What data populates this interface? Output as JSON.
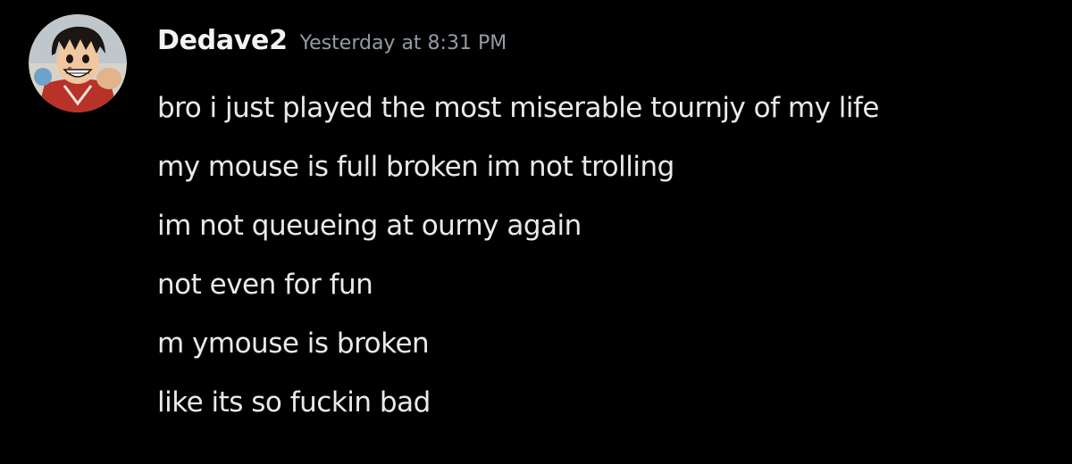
{
  "message": {
    "author": {
      "username": "Dedave2",
      "avatar": "anime-character-avatar"
    },
    "timestamp": "Yesterday at 8:31 PM",
    "lines": [
      "bro i just played the most miserable tournjy of my life",
      "my mouse is full broken im not trolling",
      "im not queueing at ourny again",
      "not even for fun",
      "m ymouse is broken",
      "like its so fuckin bad"
    ]
  },
  "colors": {
    "background": "#000000",
    "username": "#f2f3f5",
    "timestamp": "#949ba4",
    "text": "#e8e9ec"
  }
}
